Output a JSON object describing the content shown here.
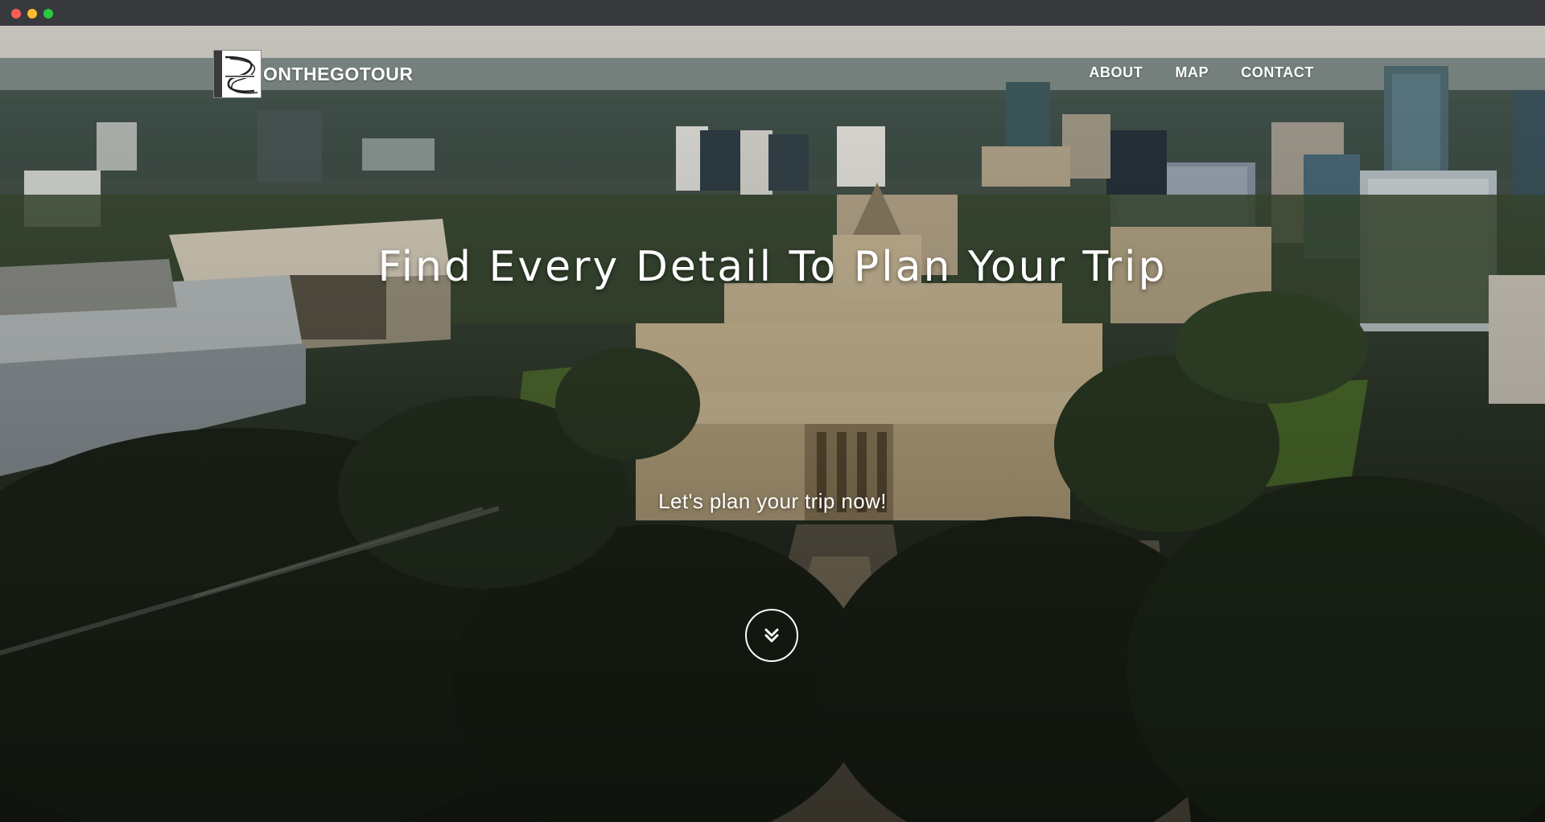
{
  "brand": {
    "name": "ONTHEGOTOUR",
    "logo_icon": "onthego-logo-icon"
  },
  "nav": {
    "items": [
      {
        "label": "ABOUT"
      },
      {
        "label": "MAP"
      },
      {
        "label": "CONTACT"
      }
    ]
  },
  "hero": {
    "headline": "Find Every Detail To Plan Your Trip",
    "subheadline": "Let's plan your trip now!",
    "scroll_icon": "double-chevron-down-icon"
  },
  "colors": {
    "text": "#ffffff",
    "titlebar": "#38393d"
  }
}
